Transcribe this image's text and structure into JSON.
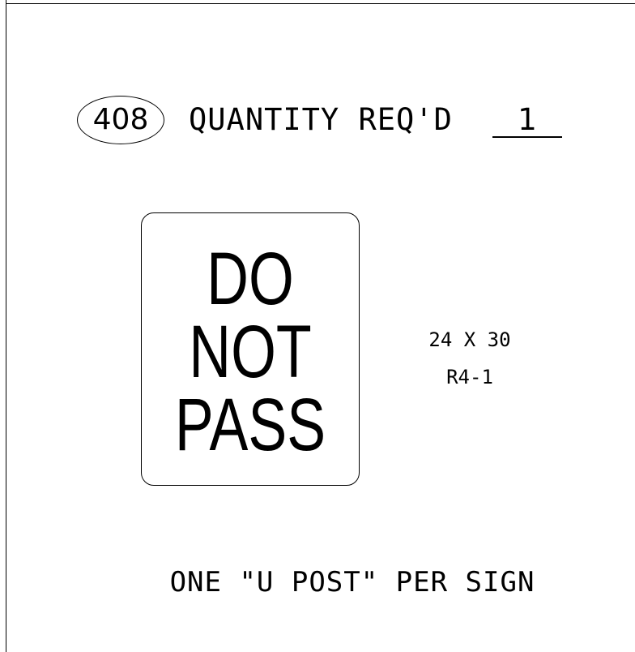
{
  "header": {
    "item_number": "408",
    "quantity_label": "QUANTITY REQ'D",
    "quantity_value": "1"
  },
  "sign": {
    "legend_lines": [
      "DO",
      "NOT",
      "PASS"
    ],
    "size": "24 X 30",
    "code": "R4-1"
  },
  "footer": {
    "post_note": "ONE \"U POST\" PER SIGN"
  }
}
